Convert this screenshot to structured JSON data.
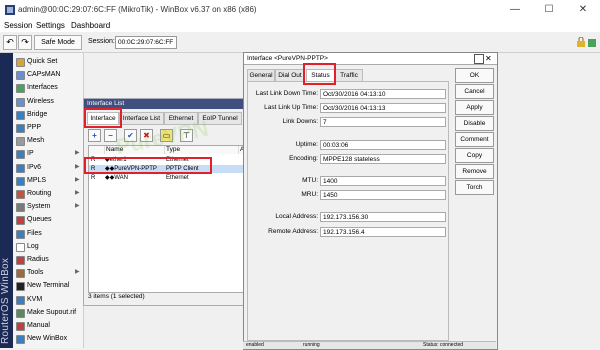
{
  "titlebar": {
    "title": "admin@00:0C:29:07:6C:FF (MikroTik) - WinBox v6.37 on x86 (x86)",
    "minimize": "—",
    "maximize": "☐",
    "close": "✕"
  },
  "menubar": [
    "Session",
    "Settings",
    "Dashboard"
  ],
  "toolbar": {
    "undo_icon": "↶",
    "redo_icon": "↷",
    "safe_mode": "Safe Mode",
    "session_label": "Session:",
    "session_value": "00:0C:29:07:6C:FF"
  },
  "sidestrip_text": "RouterOS WinBox",
  "sidebar": [
    {
      "label": "Quick Set",
      "icon_color": "#d9a23a",
      "arrow": ""
    },
    {
      "label": "CAPsMAN",
      "icon_color": "#6a8fd0",
      "arrow": ""
    },
    {
      "label": "Interfaces",
      "icon_color": "#4aa35a",
      "arrow": ""
    },
    {
      "label": "Wireless",
      "icon_color": "#6a8fd0",
      "arrow": ""
    },
    {
      "label": "Bridge",
      "icon_color": "#3a7fbf",
      "arrow": ""
    },
    {
      "label": "PPP",
      "icon_color": "#3a7fbf",
      "arrow": ""
    },
    {
      "label": "Mesh",
      "icon_color": "#9a9a9a",
      "arrow": ""
    },
    {
      "label": "IP",
      "icon_color": "#3a7fbf",
      "arrow": "▶"
    },
    {
      "label": "IPv6",
      "icon_color": "#3a7fbf",
      "arrow": "▶"
    },
    {
      "label": "MPLS",
      "icon_color": "#3a7fbf",
      "arrow": "▶"
    },
    {
      "label": "Routing",
      "icon_color": "#c0563a",
      "arrow": "▶"
    },
    {
      "label": "System",
      "icon_color": "#7a7a7a",
      "arrow": "▶"
    },
    {
      "label": "Queues",
      "icon_color": "#c04040",
      "arrow": ""
    },
    {
      "label": "Files",
      "icon_color": "#3a7fbf",
      "arrow": ""
    },
    {
      "label": "Log",
      "icon_color": "#ffffff",
      "arrow": ""
    },
    {
      "label": "Radius",
      "icon_color": "#c04040",
      "arrow": ""
    },
    {
      "label": "Tools",
      "icon_color": "#9a6a3a",
      "arrow": "▶"
    },
    {
      "label": "New Terminal",
      "icon_color": "#222222",
      "arrow": ""
    },
    {
      "label": "KVM",
      "icon_color": "#3a7fbf",
      "arrow": ""
    },
    {
      "label": "Make Supout.rif",
      "icon_color": "#5a8a5a",
      "arrow": ""
    },
    {
      "label": "Manual",
      "icon_color": "#c04040",
      "arrow": ""
    },
    {
      "label": "New WinBox",
      "icon_color": "#3a7fbf",
      "arrow": ""
    }
  ],
  "interface_list": {
    "title": "Interface List",
    "tabs": [
      "Interface",
      "Interface List",
      "Ethernet",
      "EoIP Tunnel"
    ],
    "toolbar_icons": [
      "+",
      "−",
      "✔",
      "✖",
      "▭",
      "⊤"
    ],
    "columns": [
      "Name",
      "Type",
      "A"
    ],
    "rows": [
      {
        "flag": "R",
        "name": "◆ether1",
        "type": "Ethernet"
      },
      {
        "flag": "R",
        "name": "◆◆PureVPN-PPTP",
        "type": "PPTP Client"
      },
      {
        "flag": "R",
        "name": "◆◆WAN",
        "type": "Ethernet"
      }
    ],
    "status": "3 items (1 selected)"
  },
  "interface_dialog": {
    "title": "Interface <PureVPN-PPTP>",
    "tabs": [
      "General",
      "Dial Out",
      "Status",
      "Traffic"
    ],
    "fields": [
      {
        "label": "Last Link Down Time:",
        "value": "Oct/30/2016 04:13:10"
      },
      {
        "label": "Last Link Up Time:",
        "value": "Oct/30/2016 04:13:13"
      },
      {
        "label": "Link Downs:",
        "value": "7"
      },
      {
        "label": "Uptime:",
        "value": "00:03:06"
      },
      {
        "label": "Encoding:",
        "value": "MPPE128 stateless"
      },
      {
        "label": "MTU:",
        "value": "1400"
      },
      {
        "label": "MRU:",
        "value": "1450"
      },
      {
        "label": "Local Address:",
        "value": "192.173.156.30"
      },
      {
        "label": "Remote Address:",
        "value": "192.173.156.4"
      }
    ],
    "buttons": [
      "OK",
      "Cancel",
      "Apply",
      "Disable",
      "Comment",
      "Copy",
      "Remove",
      "Torch"
    ],
    "footer": {
      "left": "enabled",
      "mid": "running",
      "right": "Status: connected"
    }
  },
  "watermark": "PureVPN",
  "colors": {
    "highlight": "#e0202a",
    "selected_row": "#c7dcf5",
    "side_strip": "#1b2a55"
  }
}
